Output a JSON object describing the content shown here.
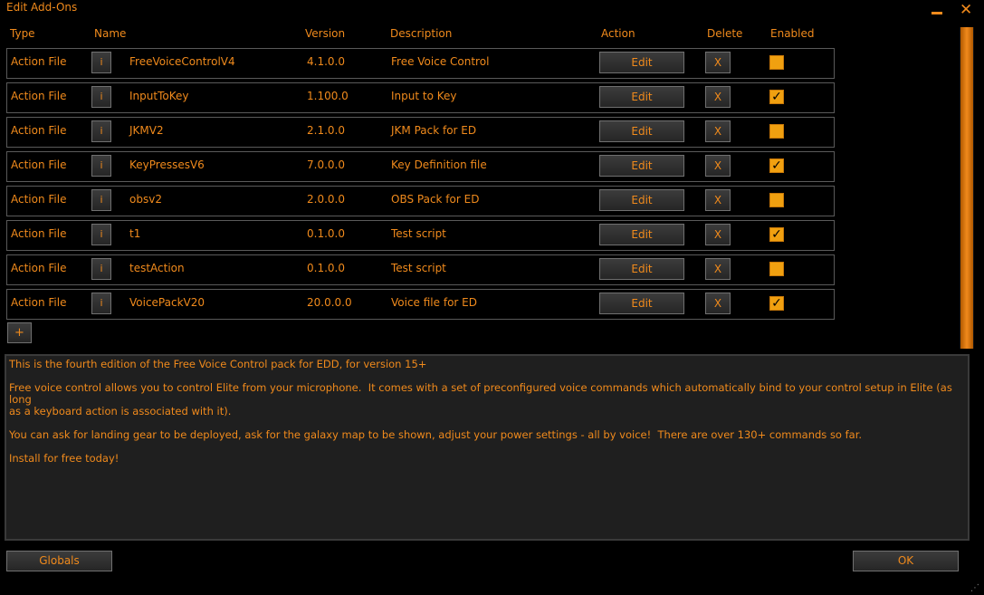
{
  "window": {
    "title": "Edit Add-Ons",
    "close_glyph": "✕"
  },
  "headers": {
    "type": "Type",
    "name": "Name",
    "version": "Version",
    "description": "Description",
    "action": "Action",
    "delete": "Delete",
    "enabled": "Enabled"
  },
  "rows": [
    {
      "type": "Action File",
      "info": "i",
      "name": "FreeVoiceControlV4",
      "version": "4.1.0.0",
      "description": "Free Voice Control",
      "edit": "Edit",
      "delete": "X",
      "enabled": false
    },
    {
      "type": "Action File",
      "info": "i",
      "name": "InputToKey",
      "version": "1.100.0",
      "description": "Input to Key",
      "edit": "Edit",
      "delete": "X",
      "enabled": true
    },
    {
      "type": "Action File",
      "info": "i",
      "name": "JKMV2",
      "version": "2.1.0.0",
      "description": "JKM Pack for ED",
      "edit": "Edit",
      "delete": "X",
      "enabled": false
    },
    {
      "type": "Action File",
      "info": "i",
      "name": "KeyPressesV6",
      "version": "7.0.0.0",
      "description": "Key Definition file",
      "edit": "Edit",
      "delete": "X",
      "enabled": true
    },
    {
      "type": "Action File",
      "info": "i",
      "name": "obsv2",
      "version": "2.0.0.0",
      "description": "OBS Pack for ED",
      "edit": "Edit",
      "delete": "X",
      "enabled": false
    },
    {
      "type": "Action File",
      "info": "i",
      "name": "t1",
      "version": "0.1.0.0",
      "description": "Test script",
      "edit": "Edit",
      "delete": "X",
      "enabled": true
    },
    {
      "type": "Action File",
      "info": "i",
      "name": "testAction",
      "version": "0.1.0.0",
      "description": "Test script",
      "edit": "Edit",
      "delete": "X",
      "enabled": false
    },
    {
      "type": "Action File",
      "info": "i",
      "name": "VoicePackV20",
      "version": "20.0.0.0",
      "description": "Voice file for ED",
      "edit": "Edit",
      "delete": "X",
      "enabled": true
    }
  ],
  "add_label": "+",
  "description_text": "This is the fourth edition of the Free Voice Control pack for EDD, for version 15+\n\nFree voice control allows you to control Elite from your microphone.  It comes with a set of preconfigured voice commands which automatically bind to your control setup in Elite (as long\nas a keyboard action is associated with it).\n\nYou can ask for landing gear to be deployed, ask for the galaxy map to be shown, adjust your power settings - all by voice!  There are over 130+ commands so far.\n\nInstall for free today!",
  "footer": {
    "globals_label": "Globals",
    "ok_label": "OK"
  },
  "colors": {
    "accent": "#f08a1c",
    "background": "#000000",
    "checkbox": "#f0a010"
  }
}
